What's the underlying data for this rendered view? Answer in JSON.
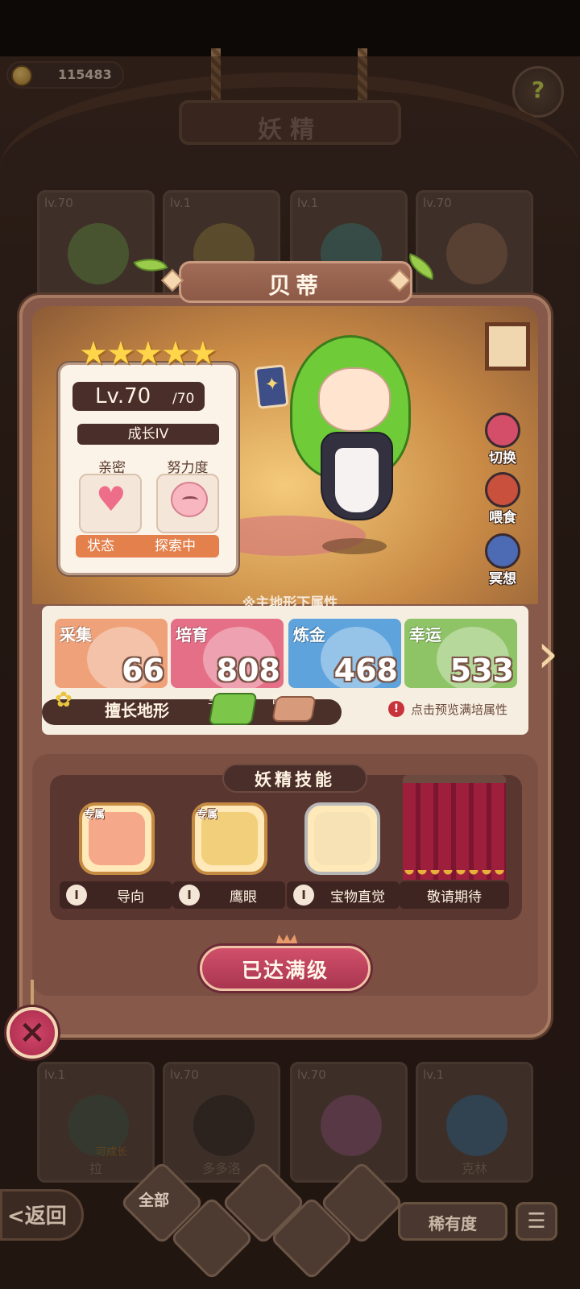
{
  "topbar": {
    "coins": "115483",
    "screen_title": "妖精",
    "help_icon": "question-icon"
  },
  "background_cards_top": [
    {
      "level": "lv.70"
    },
    {
      "level": "lv.1"
    },
    {
      "level": "lv.1"
    },
    {
      "level": "lv.70"
    }
  ],
  "background_cards_bottom": [
    {
      "level": "lv.1",
      "name": "拉",
      "tag": "可成长"
    },
    {
      "level": "lv.70",
      "name": "多多洛"
    },
    {
      "level": "lv.70",
      "name": ""
    },
    {
      "level": "lv.1",
      "name": "克林"
    }
  ],
  "fairy": {
    "name": "贝蒂",
    "stars": 5,
    "level": "Lv.70",
    "level_max": "/70",
    "growth": "成长IV",
    "intimacy_label": "亲密",
    "effort_label": "努力度",
    "status_label": "状态",
    "status_value": "探索中"
  },
  "side_actions": [
    {
      "label": "切换",
      "icon": "switch-icon",
      "color": "#d44e6a"
    },
    {
      "label": "喂食",
      "icon": "meat-icon",
      "color": "#c9503c"
    },
    {
      "label": "冥想",
      "icon": "meditate-icon",
      "color": "#4c6bb4"
    }
  ],
  "attributes": {
    "caption": "※主地形下属性",
    "stats": [
      {
        "name": "采集",
        "value": "66",
        "color": "#efa27a"
      },
      {
        "name": "培育",
        "value": "808",
        "color": "#e56f86"
      },
      {
        "name": "炼金",
        "value": "468",
        "color": "#5ea3dc"
      },
      {
        "name": "幸运",
        "value": "533",
        "color": "#8fc466"
      }
    ],
    "terrain_label": "擅长地形",
    "terrain_main_tag": "主",
    "terrain_sub_tag": "副",
    "preview_hint": "点击预览满培属性"
  },
  "skills": {
    "title": "妖精技能",
    "exclusive_tag": "专属",
    "items": [
      {
        "label": "导向",
        "exclusive": true,
        "level_icon": "I",
        "color": "#f5a88a"
      },
      {
        "label": "鹰眼",
        "exclusive": true,
        "level_icon": "I",
        "color": "#f2cf7a"
      },
      {
        "label": "宝物直觉",
        "exclusive": false,
        "level_icon": "I",
        "color": "#f6e2b4"
      },
      {
        "label": "敬请期待",
        "exclusive": false,
        "level_icon": "",
        "color": "#9d1f3c"
      }
    ]
  },
  "max_button": "已达满级",
  "bottom": {
    "back": "<返回",
    "filter_all": "全部",
    "rarity": "稀有度",
    "list_icon": "list-icon"
  }
}
